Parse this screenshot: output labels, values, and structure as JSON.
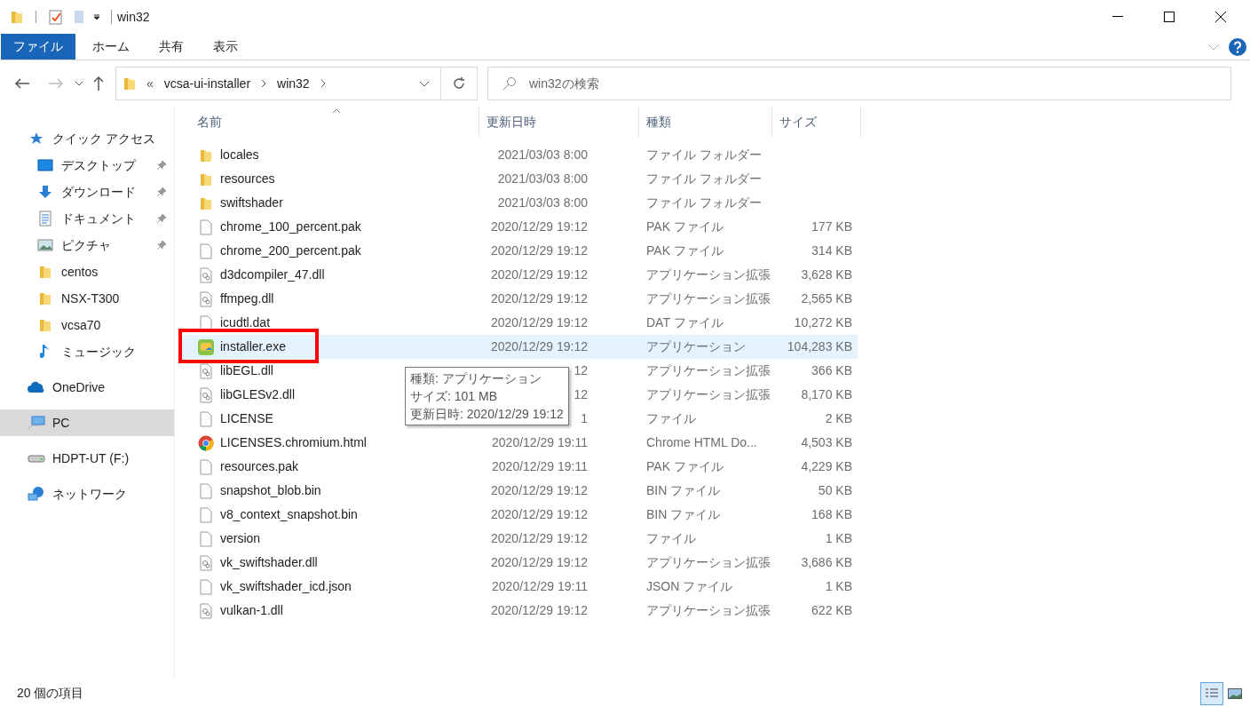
{
  "window": {
    "title": "win32"
  },
  "ribbon_tabs": [
    {
      "label": "ファイル",
      "selected": true
    },
    {
      "label": "ホーム",
      "selected": false
    },
    {
      "label": "共有",
      "selected": false
    },
    {
      "label": "表示",
      "selected": false
    }
  ],
  "address": {
    "overflow": "«",
    "segments": [
      "vcsa-ui-installer",
      "win32"
    ]
  },
  "search": {
    "placeholder": "win32の検索"
  },
  "sidebar": {
    "items": [
      {
        "label": "クイック アクセス",
        "selected": false,
        "pinned": false,
        "children": [
          {
            "label": "デスクトップ",
            "selected": false,
            "pinned": true
          },
          {
            "label": "ダウンロード",
            "selected": false,
            "pinned": true
          },
          {
            "label": "ドキュメント",
            "selected": false,
            "pinned": true
          },
          {
            "label": "ピクチャ",
            "selected": false,
            "pinned": true
          },
          {
            "label": "centos",
            "selected": false,
            "pinned": false
          },
          {
            "label": "NSX-T300",
            "selected": false,
            "pinned": false
          },
          {
            "label": "vcsa70",
            "selected": false,
            "pinned": false
          },
          {
            "label": "ミュージック",
            "selected": false,
            "pinned": false
          }
        ]
      },
      {
        "label": "OneDrive",
        "selected": false,
        "pinned": false
      },
      {
        "label": "PC",
        "selected": true,
        "pinned": false
      },
      {
        "label": "HDPT-UT (F:)",
        "selected": false,
        "pinned": false
      },
      {
        "label": "ネットワーク",
        "selected": false,
        "pinned": false
      }
    ]
  },
  "table": {
    "columns": [
      "名前",
      "更新日時",
      "種類",
      "サイズ"
    ],
    "rows": [
      {
        "name": "locales",
        "date": "2021/03/03 8:00",
        "type": "ファイル フォルダー",
        "kind": "folder",
        "selected": false,
        "highlighted": false
      },
      {
        "name": "resources",
        "date": "2021/03/03 8:00",
        "type": "ファイル フォルダー",
        "kind": "folder",
        "selected": false,
        "highlighted": false
      },
      {
        "name": "swiftshader",
        "date": "2021/03/03 8:00",
        "type": "ファイル フォルダー",
        "kind": "folder",
        "selected": false,
        "highlighted": false
      },
      {
        "name": "chrome_100_percent.pak",
        "date": "2020/12/29 19:12",
        "type": "PAK ファイル",
        "size": "177 KB",
        "kind": "file",
        "selected": false,
        "highlighted": false
      },
      {
        "name": "chrome_200_percent.pak",
        "date": "2020/12/29 19:12",
        "type": "PAK ファイル",
        "size": "314 KB",
        "kind": "file",
        "selected": false,
        "highlighted": false
      },
      {
        "name": "d3dcompiler_47.dll",
        "date": "2020/12/29 19:12",
        "type": "アプリケーション拡張",
        "size": "3,628 KB",
        "kind": "dll",
        "selected": false,
        "highlighted": false
      },
      {
        "name": "ffmpeg.dll",
        "date": "2020/12/29 19:12",
        "type": "アプリケーション拡張",
        "size": "2,565 KB",
        "kind": "dll",
        "selected": false,
        "highlighted": false
      },
      {
        "name": "icudtl.dat",
        "date": "2020/12/29 19:12",
        "type": "DAT ファイル",
        "size": "10,272 KB",
        "kind": "file",
        "selected": false,
        "highlighted": false
      },
      {
        "name": "installer.exe",
        "date": "2020/12/29 19:12",
        "type": "アプリケーション",
        "size": "104,283 KB",
        "kind": "exe",
        "selected": true,
        "highlighted": true
      },
      {
        "name": "libEGL.dll",
        "date": "12",
        "type": "アプリケーション拡張",
        "size": "366 KB",
        "kind": "dll",
        "selected": false,
        "highlighted": false
      },
      {
        "name": "libGLESv2.dll",
        "date": "12",
        "type": "アプリケーション拡張",
        "size": "8,170 KB",
        "kind": "dll",
        "selected": false,
        "highlighted": false
      },
      {
        "name": "LICENSE",
        "date": "1",
        "type": "ファイル",
        "size": "2 KB",
        "kind": "file",
        "selected": false,
        "highlighted": false
      },
      {
        "name": "LICENSES.chromium.html",
        "date": "2020/12/29 19:11",
        "type": "Chrome HTML Do...",
        "size": "4,503 KB",
        "kind": "chrome",
        "selected": false,
        "highlighted": false
      },
      {
        "name": "resources.pak",
        "date": "2020/12/29 19:11",
        "type": "PAK ファイル",
        "size": "4,229 KB",
        "kind": "file",
        "selected": false,
        "highlighted": false
      },
      {
        "name": "snapshot_blob.bin",
        "date": "2020/12/29 19:12",
        "type": "BIN ファイル",
        "size": "50 KB",
        "kind": "file",
        "selected": false,
        "highlighted": false
      },
      {
        "name": "v8_context_snapshot.bin",
        "date": "2020/12/29 19:12",
        "type": "BIN ファイル",
        "size": "168 KB",
        "kind": "file",
        "selected": false,
        "highlighted": false
      },
      {
        "name": "version",
        "date": "2020/12/29 19:12",
        "type": "ファイル",
        "size": "1 KB",
        "kind": "file",
        "selected": false,
        "highlighted": false
      },
      {
        "name": "vk_swiftshader.dll",
        "date": "2020/12/29 19:12",
        "type": "アプリケーション拡張",
        "size": "3,686 KB",
        "kind": "dll",
        "selected": false,
        "highlighted": false
      },
      {
        "name": "vk_swiftshader_icd.json",
        "date": "2020/12/29 19:11",
        "type": "JSON ファイル",
        "size": "1 KB",
        "kind": "file",
        "selected": false,
        "highlighted": false
      },
      {
        "name": "vulkan-1.dll",
        "date": "2020/12/29 19:12",
        "type": "アプリケーション拡張",
        "size": "622 KB",
        "kind": "dll",
        "selected": false,
        "highlighted": false
      }
    ]
  },
  "tooltip": [
    "種類: アプリケーション",
    "サイズ: 101 MB",
    "更新日時: 2020/12/29 19:12"
  ],
  "status_bar": {
    "count": "20 個の項目"
  },
  "view_buttons": [
    {
      "kind": "details",
      "selected": true
    },
    {
      "kind": "thumbnails",
      "selected": false
    }
  ]
}
